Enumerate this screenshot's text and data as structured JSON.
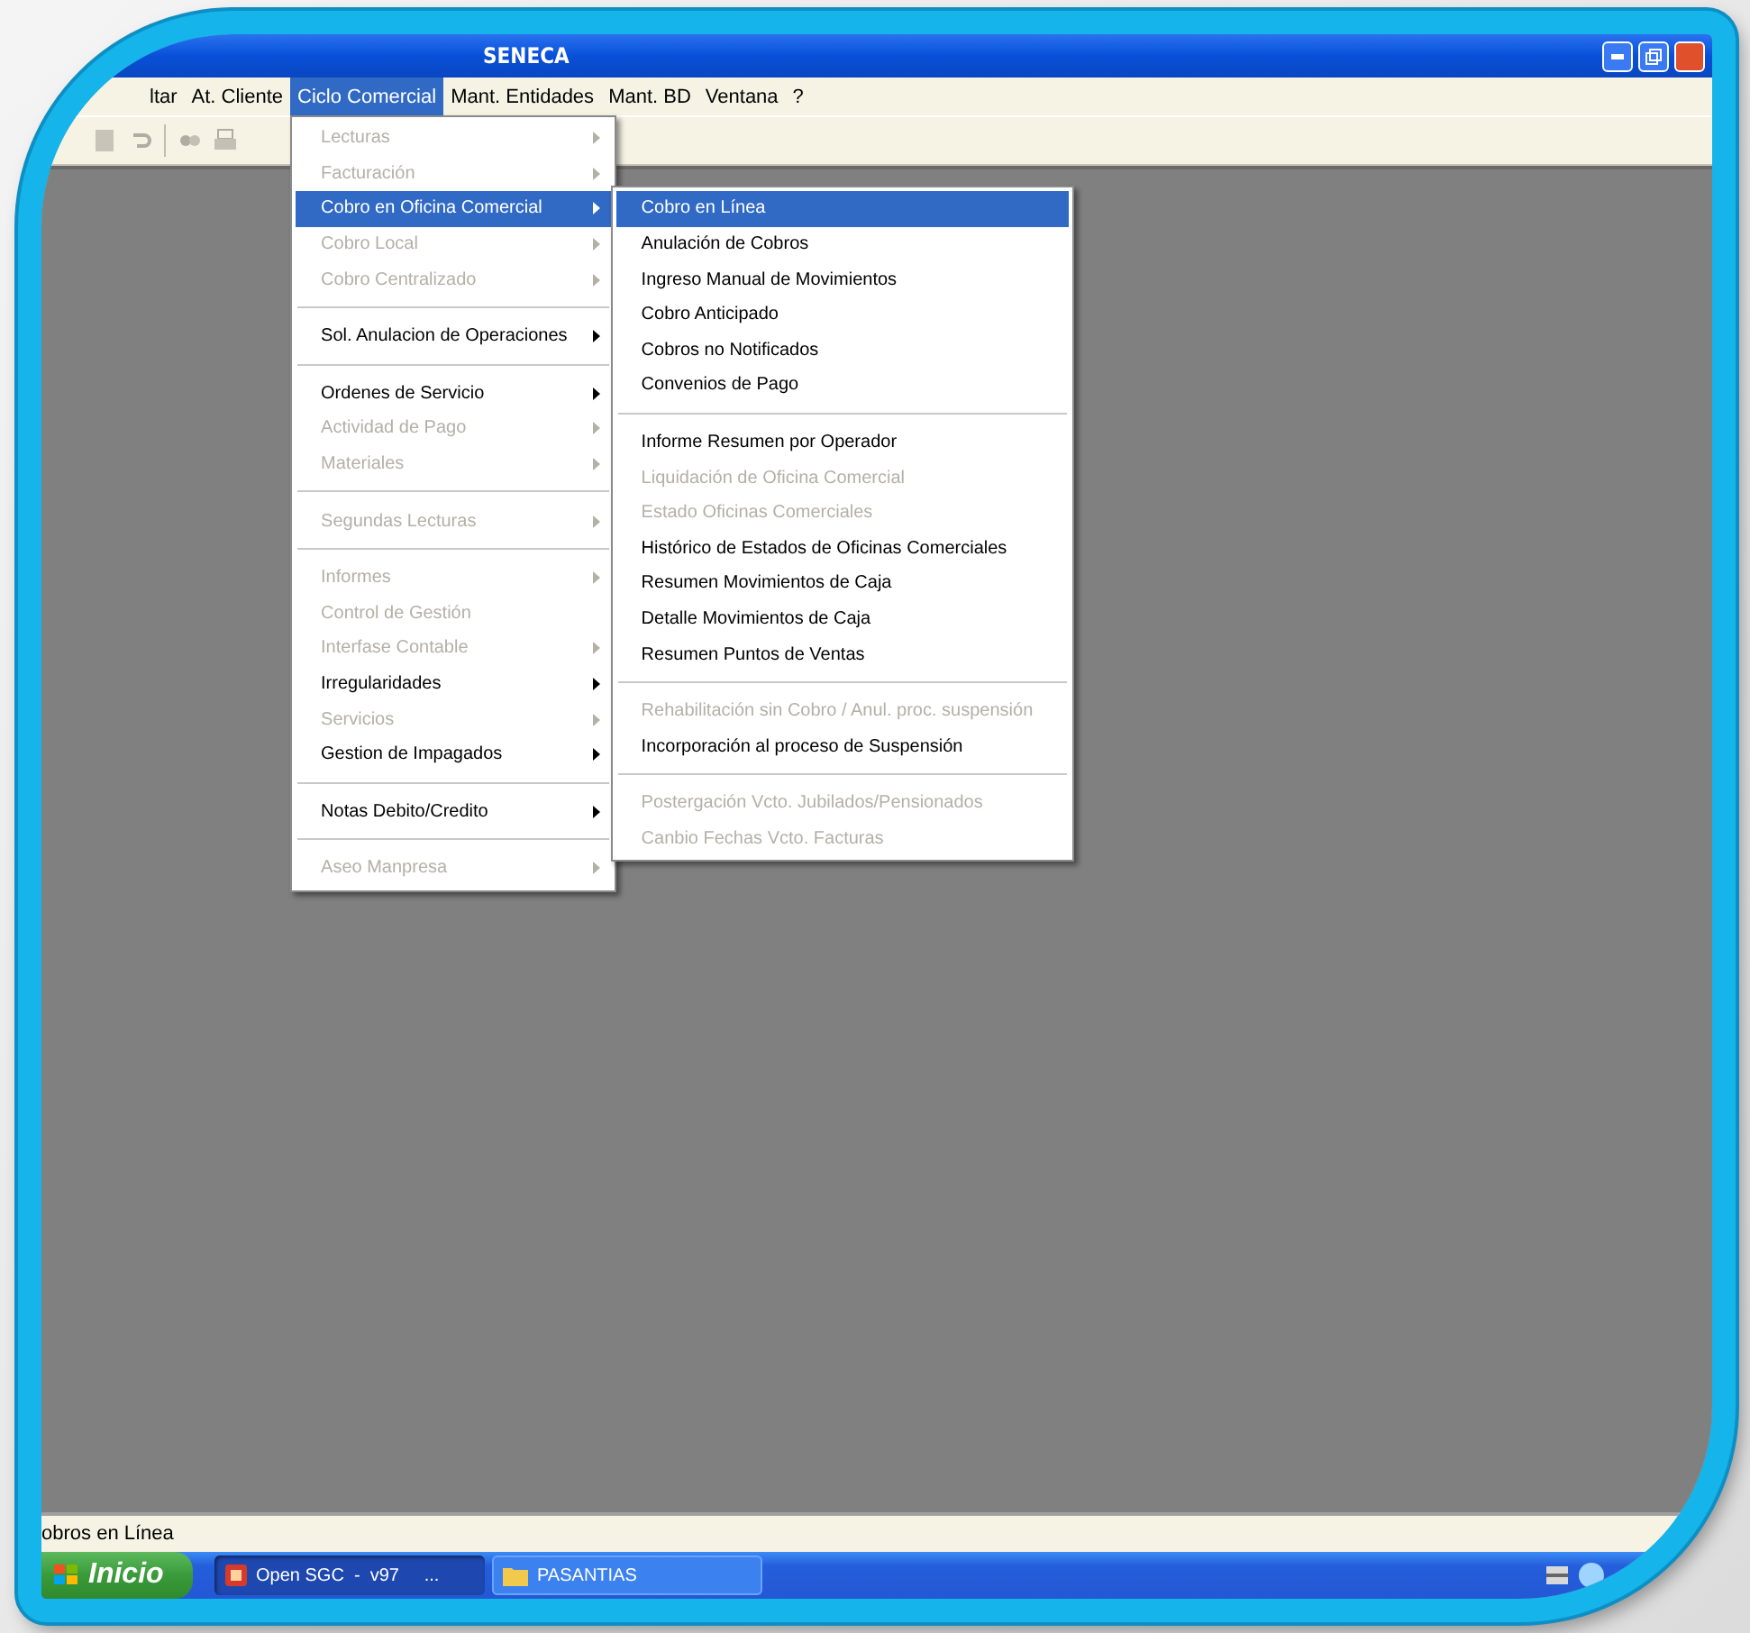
{
  "window": {
    "title": "SENECA"
  },
  "menu_bar": [
    {
      "label": "ltar",
      "selected": false
    },
    {
      "label": "At. Cliente",
      "selected": false
    },
    {
      "label": "Ciclo Comercial",
      "selected": true
    },
    {
      "label": "Mant. Entidades",
      "selected": false
    },
    {
      "label": "Mant. BD",
      "selected": false
    },
    {
      "label": "Ventana",
      "selected": false
    },
    {
      "label": "?",
      "selected": false
    }
  ],
  "menu": {
    "items": [
      {
        "kind": "item",
        "label": "Lecturas",
        "disabled": true,
        "has_submenu": true,
        "selected": false
      },
      {
        "kind": "item",
        "label": "Facturación",
        "disabled": true,
        "has_submenu": true,
        "selected": false
      },
      {
        "kind": "item",
        "label": "Cobro en Oficina Comercial",
        "disabled": false,
        "has_submenu": true,
        "selected": true
      },
      {
        "kind": "item",
        "label": "Cobro Local",
        "disabled": true,
        "has_submenu": true,
        "selected": false
      },
      {
        "kind": "item",
        "label": "Cobro Centralizado",
        "disabled": true,
        "has_submenu": true,
        "selected": false
      },
      {
        "kind": "separator"
      },
      {
        "kind": "item",
        "label": "Sol. Anulacion de Operaciones",
        "disabled": false,
        "has_submenu": true,
        "selected": false
      },
      {
        "kind": "separator"
      },
      {
        "kind": "item",
        "label": "Ordenes de Servicio",
        "disabled": false,
        "has_submenu": true,
        "selected": false
      },
      {
        "kind": "item",
        "label": "Actividad de Pago",
        "disabled": true,
        "has_submenu": true,
        "selected": false
      },
      {
        "kind": "item",
        "label": "Materiales",
        "disabled": true,
        "has_submenu": true,
        "selected": false
      },
      {
        "kind": "separator"
      },
      {
        "kind": "item",
        "label": "Segundas Lecturas",
        "disabled": true,
        "has_submenu": true,
        "selected": false
      },
      {
        "kind": "separator"
      },
      {
        "kind": "item",
        "label": "Informes",
        "disabled": true,
        "has_submenu": true,
        "selected": false
      },
      {
        "kind": "item",
        "label": "Control de Gestión",
        "disabled": true,
        "has_submenu": false,
        "selected": false
      },
      {
        "kind": "item",
        "label": "Interfase Contable",
        "disabled": true,
        "has_submenu": true,
        "selected": false
      },
      {
        "kind": "item",
        "label": "Irregularidades",
        "disabled": false,
        "has_submenu": true,
        "selected": false
      },
      {
        "kind": "item",
        "label": "Servicios",
        "disabled": true,
        "has_submenu": true,
        "selected": false
      },
      {
        "kind": "item",
        "label": "Gestion de Impagados",
        "disabled": false,
        "has_submenu": true,
        "selected": false
      },
      {
        "kind": "separator"
      },
      {
        "kind": "item",
        "label": "Notas Debito/Credito",
        "disabled": false,
        "has_submenu": true,
        "selected": false
      },
      {
        "kind": "separator"
      },
      {
        "kind": "item",
        "label": "Aseo Manpresa",
        "disabled": true,
        "has_submenu": true,
        "selected": false
      }
    ]
  },
  "submenu": {
    "items": [
      {
        "kind": "item",
        "label": "Cobro en Línea",
        "disabled": false,
        "selected": true
      },
      {
        "kind": "item",
        "label": "Anulación de Cobros",
        "disabled": false,
        "selected": false
      },
      {
        "kind": "item",
        "label": "Ingreso Manual de Movimientos",
        "disabled": false,
        "selected": false
      },
      {
        "kind": "item",
        "label": "Cobro Anticipado",
        "disabled": false,
        "selected": false
      },
      {
        "kind": "item",
        "label": "Cobros no Notificados",
        "disabled": false,
        "selected": false
      },
      {
        "kind": "item",
        "label": "Convenios de Pago",
        "disabled": false,
        "selected": false
      },
      {
        "kind": "separator"
      },
      {
        "kind": "item",
        "label": "Informe Resumen por Operador",
        "disabled": false,
        "selected": false
      },
      {
        "kind": "item",
        "label": "Liquidación de Oficina Comercial",
        "disabled": true,
        "selected": false
      },
      {
        "kind": "item",
        "label": "Estado Oficinas Comerciales",
        "disabled": true,
        "selected": false
      },
      {
        "kind": "item",
        "label": "Histórico de Estados de Oficinas Comerciales",
        "disabled": false,
        "selected": false
      },
      {
        "kind": "item",
        "label": "Resumen Movimientos de Caja",
        "disabled": false,
        "selected": false
      },
      {
        "kind": "item",
        "label": "Detalle Movimientos de Caja",
        "disabled": false,
        "selected": false
      },
      {
        "kind": "item",
        "label": "Resumen Puntos de Ventas",
        "disabled": false,
        "selected": false
      },
      {
        "kind": "separator"
      },
      {
        "kind": "item",
        "label": "Rehabilitación sin Cobro  / Anul. proc. suspensión",
        "disabled": true,
        "selected": false
      },
      {
        "kind": "item",
        "label": "Incorporación al proceso de Suspensión",
        "disabled": false,
        "selected": false
      },
      {
        "kind": "separator"
      },
      {
        "kind": "item",
        "label": "Postergación Vcto. Jubilados/Pensionados",
        "disabled": true,
        "selected": false
      },
      {
        "kind": "item",
        "label": "Canbio Fechas Vcto. Facturas",
        "disabled": true,
        "selected": false
      }
    ]
  },
  "status_bar": {
    "text": "obros en Línea"
  },
  "taskbar": {
    "start": "Inicio",
    "tasks": [
      {
        "label": "Open SGC  -  v97     ...",
        "kind": "app",
        "selected": true
      },
      {
        "label": "PASANTIAS",
        "kind": "folder",
        "selected": false
      }
    ]
  }
}
